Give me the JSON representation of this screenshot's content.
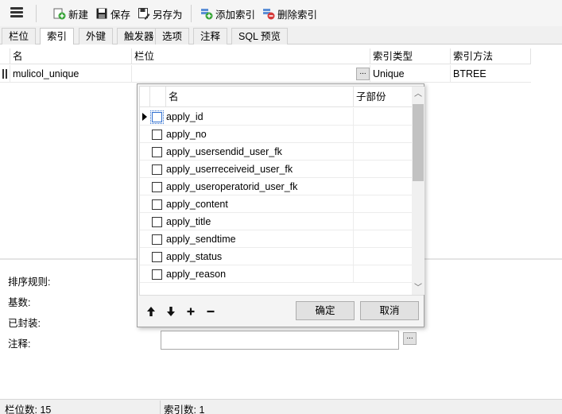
{
  "toolbar": {
    "new_label": "新建",
    "save_label": "保存",
    "saveas_label": "另存为",
    "add_index_label": "添加索引",
    "delete_index_label": "删除索引"
  },
  "tabs": [
    {
      "label": "栏位"
    },
    {
      "label": "索引",
      "active": true
    },
    {
      "label": "外键"
    },
    {
      "label": "触发器"
    },
    {
      "label": "选项"
    },
    {
      "label": "注释"
    },
    {
      "label": "SQL 预览"
    }
  ],
  "grid": {
    "columns": [
      "名",
      "栏位",
      "索引类型",
      "索引方法"
    ],
    "rows": [
      {
        "name": "mulicol_unique",
        "fields": "",
        "index_type": "Unique",
        "index_method": "BTREE"
      }
    ],
    "ellipsis_label": "..."
  },
  "popup": {
    "columns": [
      "名",
      "子部份"
    ],
    "items": [
      {
        "name": "apply_id",
        "checked": false
      },
      {
        "name": "apply_no",
        "checked": false
      },
      {
        "name": "apply_usersendid_user_fk",
        "checked": false
      },
      {
        "name": "apply_userreceiveid_user_fk",
        "checked": false
      },
      {
        "name": "apply_useroperatorid_user_fk",
        "checked": false
      },
      {
        "name": "apply_content",
        "checked": false
      },
      {
        "name": "apply_title",
        "checked": false
      },
      {
        "name": "apply_sendtime",
        "checked": false
      },
      {
        "name": "apply_status",
        "checked": false
      },
      {
        "name": "apply_reason",
        "checked": false
      }
    ],
    "ok_label": "确定",
    "cancel_label": "取消"
  },
  "details": {
    "sort_rule_label": "排序规则:",
    "cardinality_label": "基数:",
    "packed_label": "已封装:",
    "comment_label": "注释:",
    "comment_value": "",
    "ellipsis_label": "..."
  },
  "status": {
    "field_count": "栏位数: 15",
    "index_count": "索引数: 1"
  }
}
